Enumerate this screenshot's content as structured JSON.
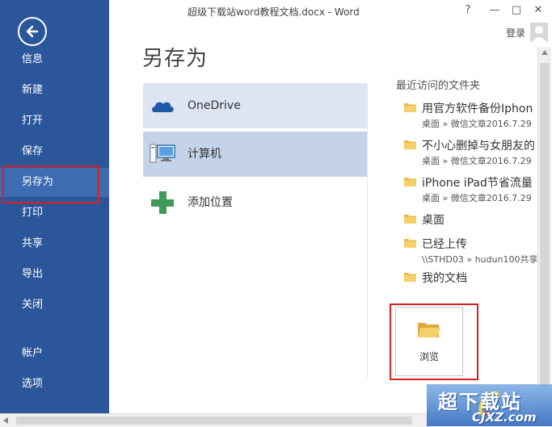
{
  "window": {
    "title": "超级下载站word教程文档.docx - Word",
    "help": "?",
    "minimize": "—",
    "maximize": "□",
    "close": "✕",
    "login": "登录"
  },
  "sidebar": {
    "back_icon": "back-arrow-icon",
    "items": [
      {
        "label": "信息"
      },
      {
        "label": "新建"
      },
      {
        "label": "打开"
      },
      {
        "label": "保存"
      },
      {
        "label": "另存为",
        "active": true
      },
      {
        "label": "打印"
      },
      {
        "label": "共享"
      },
      {
        "label": "导出"
      },
      {
        "label": "关闭"
      },
      {
        "label": "帐户"
      },
      {
        "label": "选项"
      }
    ],
    "colors": {
      "background": "#2b579a",
      "active": "#3d6cb3",
      "highlight": "#d9201f"
    }
  },
  "main": {
    "title": "另存为",
    "places": [
      {
        "label": "OneDrive",
        "icon": "cloud-icon"
      },
      {
        "label": "计算机",
        "icon": "computer-icon",
        "selected": true
      },
      {
        "label": "添加位置",
        "icon": "plus-icon"
      }
    ],
    "recent": {
      "header": "最近访问的文件夹",
      "folders": [
        {
          "name": "用官方软件备份Iphon",
          "path": "桌面 » 微信文章2016.7.29"
        },
        {
          "name": "不小心删掉与女朋友的",
          "path": "桌面 » 微信文章2016.7.29"
        },
        {
          "name": "iPhone iPad节省流量",
          "path": "桌面 » 微信文章2016.7.29"
        },
        {
          "name": "桌面",
          "path": ""
        },
        {
          "name": "已经上传",
          "path": "\\\\STHD03 » hudun100共享"
        },
        {
          "name": "我的文档",
          "path": ""
        }
      ]
    },
    "browse": {
      "label": "浏览",
      "icon": "open-folder-icon"
    }
  },
  "watermark": {
    "title": "超下载站",
    "url": "CJXZ.com"
  }
}
